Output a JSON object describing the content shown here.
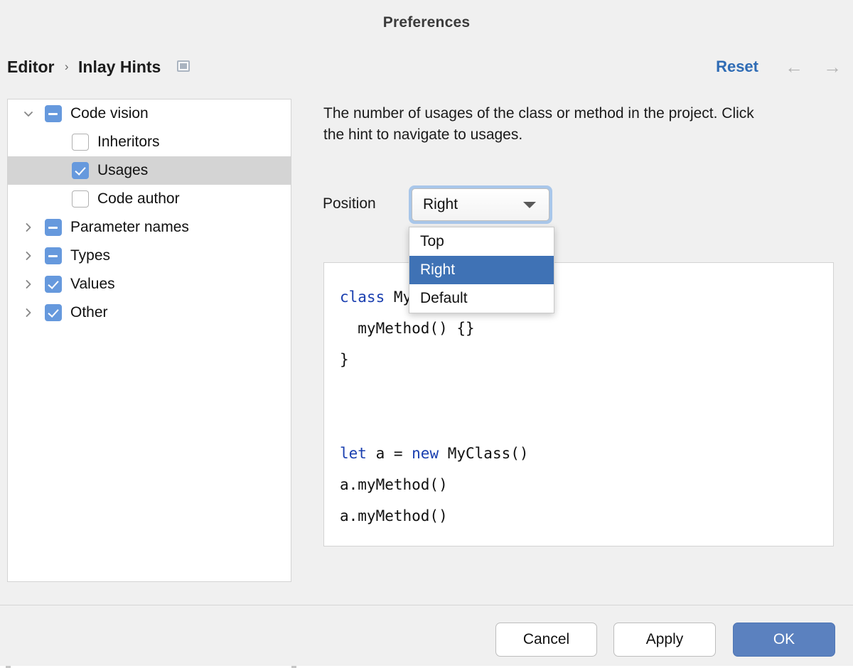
{
  "window": {
    "title": "Preferences"
  },
  "breadcrumb": {
    "root": "Editor",
    "separator": "›",
    "current": "Inlay Hints",
    "badge_icon": "inlay-hint-icon"
  },
  "header_actions": {
    "reset_label": "Reset",
    "back_icon": "←",
    "forward_icon": "→"
  },
  "tree": {
    "rows": [
      {
        "label": "Code vision",
        "indent": 0,
        "expander": "down",
        "checkbox": "mixed",
        "selected": false
      },
      {
        "label": "Inheritors",
        "indent": 1,
        "expander": "none",
        "checkbox": "off",
        "selected": false
      },
      {
        "label": "Usages",
        "indent": 1,
        "expander": "none",
        "checkbox": "on",
        "selected": true
      },
      {
        "label": "Code author",
        "indent": 1,
        "expander": "none",
        "checkbox": "off",
        "selected": false
      },
      {
        "label": "Parameter names",
        "indent": 0,
        "expander": "right",
        "checkbox": "mixed",
        "selected": false
      },
      {
        "label": "Types",
        "indent": 0,
        "expander": "right",
        "checkbox": "mixed",
        "selected": false
      },
      {
        "label": "Values",
        "indent": 0,
        "expander": "right",
        "checkbox": "on",
        "selected": false
      },
      {
        "label": "Other",
        "indent": 0,
        "expander": "right",
        "checkbox": "on",
        "selected": false
      }
    ]
  },
  "detail": {
    "description": "The number of usages of the class or method in the project. Click the hint to navigate to usages.",
    "position_label": "Position",
    "position_value": "Right",
    "position_options": [
      "Top",
      "Right",
      "Default"
    ],
    "position_selected": "Right",
    "dropdown_open": true
  },
  "preview": {
    "lines": [
      {
        "segments": [
          {
            "text": "class",
            "kind": "keyword"
          },
          {
            "text": " MyClass {",
            "kind": "plain"
          }
        ]
      },
      {
        "segments": [
          {
            "text": "  myMethod() {}",
            "kind": "plain"
          }
        ]
      },
      {
        "segments": [
          {
            "text": "}",
            "kind": "plain"
          }
        ]
      },
      {
        "segments": [
          {
            "text": "",
            "kind": "plain"
          }
        ]
      },
      {
        "segments": [
          {
            "text": "",
            "kind": "plain"
          }
        ]
      },
      {
        "segments": [
          {
            "text": "let",
            "kind": "keyword"
          },
          {
            "text": " a = ",
            "kind": "plain"
          },
          {
            "text": "new",
            "kind": "keyword"
          },
          {
            "text": " MyClass()",
            "kind": "plain"
          }
        ]
      },
      {
        "segments": [
          {
            "text": "a.myMethod()",
            "kind": "plain"
          }
        ]
      },
      {
        "segments": [
          {
            "text": "a.myMethod()",
            "kind": "plain"
          }
        ]
      }
    ]
  },
  "footer": {
    "cancel_label": "Cancel",
    "apply_label": "Apply",
    "ok_label": "OK"
  },
  "colors": {
    "background": "#f0f0f0",
    "accent_blue": "#6699dd",
    "selection_blue": "#3f72b5",
    "primary_button": "#5b81bf",
    "link_blue": "#2f6cb5",
    "row_selected_gray": "#d4d4d4",
    "code_keyword": "#1a3fb0"
  }
}
